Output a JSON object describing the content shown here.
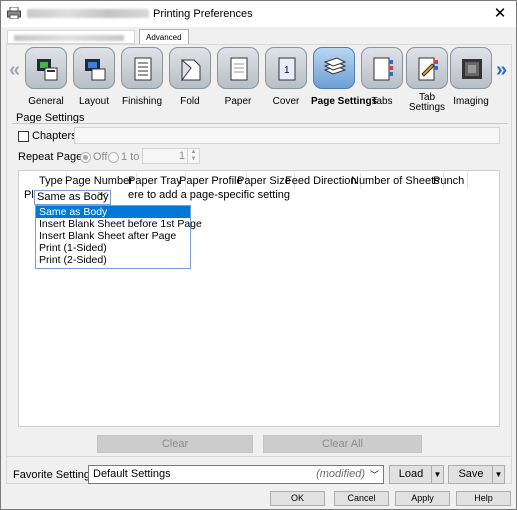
{
  "window": {
    "title": "Printing Preferences",
    "close_glyph": "✕"
  },
  "tabs": {
    "advanced_label": "Advanced"
  },
  "nav": {
    "left_arrow": "«",
    "right_arrow": "»",
    "items": [
      {
        "label": "General",
        "icon": "general-icon"
      },
      {
        "label": "Layout",
        "icon": "layout-icon"
      },
      {
        "label": "Finishing",
        "icon": "finishing-icon"
      },
      {
        "label": "Fold",
        "icon": "fold-icon"
      },
      {
        "label": "Paper",
        "icon": "paper-icon"
      },
      {
        "label": "Cover",
        "icon": "cover-icon"
      },
      {
        "label": "Page Settings",
        "icon": "page-settings-icon",
        "selected": true
      },
      {
        "label": "Tabs",
        "icon": "tabs-icon"
      },
      {
        "label": "Tab Settings",
        "icon": "tab-settings-icon"
      },
      {
        "label": "Imaging",
        "icon": "imaging-icon"
      }
    ]
  },
  "page_settings": {
    "section_title": "Page Settings",
    "chapters_label": "Chapters",
    "repeat_pages_label": "Repeat Pages",
    "radio_off_label": "Off",
    "radio_1to_label": "1 to",
    "repeat_value": "1"
  },
  "table": {
    "columns": [
      "Type",
      "Page Number",
      "Paper Tray",
      "Paper Profile",
      "Paper Size",
      "Feed Direction",
      "Number of Sheets",
      "Punch"
    ],
    "hint_prefix": "Pl",
    "hint_suffix": "ere to add a page-specific setting",
    "type_value": "Same as Body",
    "dropdown_options": [
      "Same as Body",
      "Insert Blank Sheet before 1st Page",
      "Insert Blank Sheet after Page",
      "Print (1-Sided)",
      "Print (2-Sided)"
    ]
  },
  "buttons": {
    "clear": "Clear",
    "clear_all": "Clear All",
    "load": "Load",
    "save": "Save",
    "ok": "OK",
    "cancel": "Cancel",
    "apply": "Apply",
    "help": "Help"
  },
  "favorite": {
    "label": "Favorite Setting",
    "value": "Default Settings",
    "modified": "(modified)"
  },
  "colors": {
    "accent": "#0078d7",
    "selected_icon": "#6d9fd3"
  }
}
